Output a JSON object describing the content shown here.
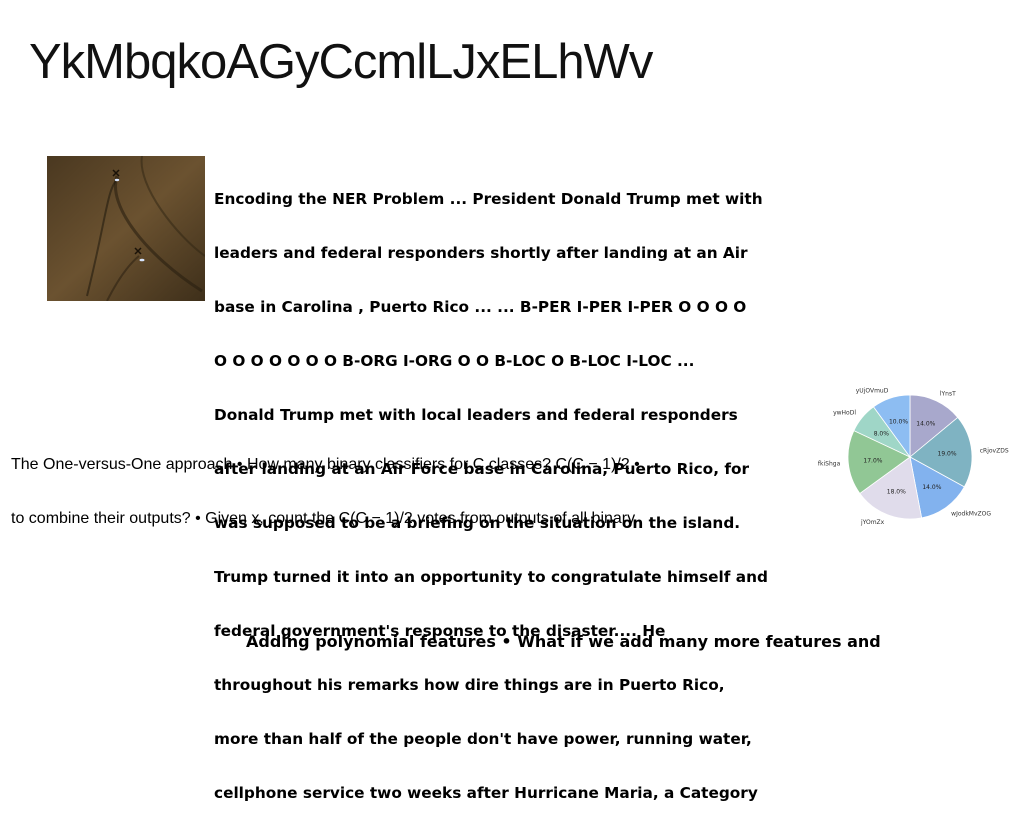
{
  "title": "YkMbqkoAGyCcmlLJxELhWv",
  "photo": {
    "description_icon": "photo-icon",
    "colors": {
      "background": "#5a4323",
      "highlight": "#8a6a3a"
    }
  },
  "ner_block": {
    "lines": [
      "Encoding the NER Problem ... President Donald Trump met with",
      "leaders and federal responders shortly after landing at an Air",
      "base in Carolina , Puerto Rico ... ... B-PER I-PER I-PER O O O O",
      "O O O O O O O B-ORG I-ORG O O B-LOC O B-LOC I-LOC ...",
      "Donald Trump met with local leaders and federal responders",
      "after landing at an Air Force base in Carolina, Puerto Rico, for",
      "was supposed to be a briefing on the situation on the island.",
      "Trump turned it into an opportunity to congratulate himself and",
      "federal government's response to the disaster.... He",
      "throughout his remarks how dire things are in Puerto Rico,",
      "more than half of the people don't have power, running water,",
      "cellphone service two weeks after Hurricane Maria, a Category"
    ]
  },
  "ovo_block": {
    "lines": [
      "The One-versus-One approach • How many binary classifiers for C classes? C(C − 1)/2 •",
      "to combine their outputs? • Given x, count the C(C − 1)/2 votes from outputs of all binary"
    ]
  },
  "poly_block": {
    "text": "Adding polynomial features • What if we add many more features and"
  },
  "chart_data": {
    "type": "pie",
    "title": "",
    "start_angle_deg": 90,
    "direction": "clockwise",
    "slices": [
      {
        "label": "lYnsT",
        "value": 14.0,
        "pct_label": "14.0%",
        "color": "#a8a8cc"
      },
      {
        "label": "cRjovZDS",
        "value": 19.0,
        "pct_label": "19.0%",
        "color": "#7fb3c2"
      },
      {
        "label": "wJodkMvZOG",
        "value": 14.0,
        "pct_label": "14.0%",
        "color": "#82b2ee"
      },
      {
        "label": "jYOmZx",
        "value": 18.0,
        "pct_label": "18.0%",
        "color": "#e0dceb"
      },
      {
        "label": "fkiShga",
        "value": 17.0,
        "pct_label": "17.0%",
        "color": "#91c795"
      },
      {
        "label": "ywHoDl",
        "value": 8.0,
        "pct_label": "8.0%",
        "color": "#9fd6c7"
      },
      {
        "label": "yUjOVmuD",
        "value": 10.0,
        "pct_label": "10.0%",
        "color": "#8dbdf2"
      }
    ]
  }
}
